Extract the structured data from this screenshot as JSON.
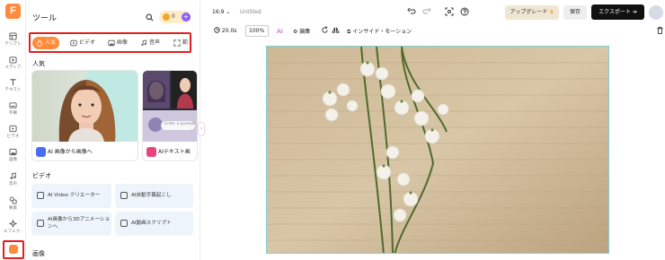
{
  "app": {
    "logo": "F",
    "colors": {
      "accent": "#ff8a3c",
      "highlight": "#e02020",
      "credits_plus": "#8b5cf6"
    }
  },
  "rail": {
    "items": [
      {
        "label": "テンプレ",
        "icon": "template-icon"
      },
      {
        "label": "メディア",
        "icon": "media-icon"
      },
      {
        "label": "テキスト",
        "icon": "text-icon"
      },
      {
        "label": "字幕",
        "icon": "subtitle-icon"
      },
      {
        "label": "ビデオ",
        "icon": "video-icon"
      },
      {
        "label": "画像",
        "icon": "image-icon"
      },
      {
        "label": "音声",
        "icon": "audio-icon"
      },
      {
        "label": "要素",
        "icon": "elements-icon"
      },
      {
        "label": "エフェク..",
        "icon": "effects-icon"
      }
    ],
    "active_icon": "tools-icon"
  },
  "panel": {
    "title": "ツール",
    "credits": "0",
    "credits_plus": "+",
    "tabs": [
      {
        "label": "人気",
        "active": true
      },
      {
        "label": "ビデオ"
      },
      {
        "label": "画像"
      },
      {
        "label": "音声"
      },
      {
        "label": "範"
      }
    ],
    "popular_heading": "人気",
    "popular_cards": [
      {
        "label": "AI 画像から画像へ"
      },
      {
        "label": "AIテキスト画"
      }
    ],
    "prompt_hint": "Enter a prompt",
    "video_heading": "ビデオ",
    "video_tools": [
      {
        "label": "AI Video クリエーター"
      },
      {
        "label": "AI自動字幕起こし"
      },
      {
        "label": "AI画像から3Dアニメーションへ"
      },
      {
        "label": "AI動画スクリプト"
      }
    ],
    "image_heading": "画像"
  },
  "header": {
    "ratio": "16:9",
    "title": "Untitled",
    "upgrade": "アップグレード",
    "save": "保存",
    "export": "エクスポート"
  },
  "toolbar": {
    "duration": "20.0s",
    "zoom": "100%",
    "edit": "編集",
    "inside_motion": "インサイド・モーション"
  }
}
